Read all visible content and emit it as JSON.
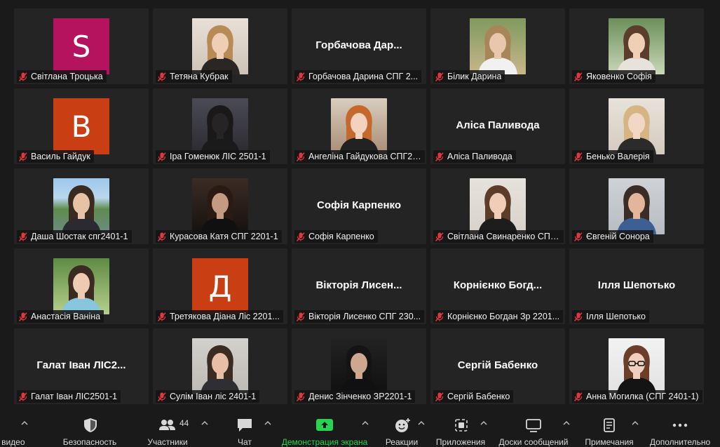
{
  "participants": [
    {
      "name": "Світлана Троцька",
      "kind": "letter",
      "letter": "S",
      "color": "#b5135d"
    },
    {
      "name": "Тетяна Кубрак",
      "kind": "photo",
      "photo": "woman-blonde"
    },
    {
      "name": "Горбачова Дарина СПГ 2...",
      "kind": "text",
      "big": "Горбачова  Дар..."
    },
    {
      "name": "Білик Дарина",
      "kind": "photo",
      "photo": "woman-outdoor"
    },
    {
      "name": "Яковенко Софія",
      "kind": "photo",
      "photo": "woman-plants"
    },
    {
      "name": "Василь Гайдук",
      "kind": "letter",
      "letter": "B",
      "color": "#c93e12"
    },
    {
      "name": "Іра Гоменюк ЛІС 2501-1",
      "kind": "photo",
      "photo": "silhouette-dusk"
    },
    {
      "name": "Ангеліна Гайдукова СПГ24...",
      "kind": "photo",
      "photo": "woman-redhair"
    },
    {
      "name": "Аліса Паливода",
      "kind": "text",
      "big": "Аліса Паливода"
    },
    {
      "name": "Бенько Валерія",
      "kind": "photo",
      "photo": "woman-light"
    },
    {
      "name": "Даша Шостак спг2401-1",
      "kind": "photo",
      "photo": "landscape-bridge"
    },
    {
      "name": "Курасова Катя СПГ 2201-1",
      "kind": "photo",
      "photo": "woman-dark"
    },
    {
      "name": "Софія Карпенко",
      "kind": "text",
      "big": "Софія Карпенко"
    },
    {
      "name": "Світлана Свинаренко СПГ ...",
      "kind": "photo",
      "photo": "woman-bun"
    },
    {
      "name": "Євгеній Сонора",
      "kind": "photo",
      "photo": "man-suit"
    },
    {
      "name": "Анастасія Ваніна",
      "kind": "photo",
      "photo": "woman-garden"
    },
    {
      "name": "Третякова Діана  Ліс 2201...",
      "kind": "letter",
      "letter": "Д",
      "color": "#c93e12"
    },
    {
      "name": "Вікторія Лисенко СПГ 230...",
      "kind": "text",
      "big": "Вікторія  Лисен..."
    },
    {
      "name": "Корнієнко Богдан Зр 2201...",
      "kind": "text",
      "big": "Корнієнко  Богд..."
    },
    {
      "name": "Ілля Шепотько",
      "kind": "text",
      "big": "Ілля Шепотько"
    },
    {
      "name": "Галат Іван ЛІС2501-1",
      "kind": "text",
      "big": "Галат Іван ЛІС2..."
    },
    {
      "name": "Сулім Іван ліс 2401-1",
      "kind": "photo",
      "photo": "man-young"
    },
    {
      "name": "Денис Зінченко ЗР2201-1",
      "kind": "photo",
      "photo": "man-hood"
    },
    {
      "name": "Сергій Бабенко",
      "kind": "text",
      "big": "Сергій Бабенко"
    },
    {
      "name": "Анна Могилка (СПГ 2401-1)",
      "kind": "photo",
      "photo": "woman-glasses"
    }
  ],
  "toolbar": {
    "video_label": "ь видео",
    "security_label": "Безопасность",
    "participants_label": "Участники",
    "participants_count": "44",
    "chat_label": "Чат",
    "share_label": "Демонстрация экрана",
    "reactions_label": "Реакции",
    "apps_label": "Приложения",
    "whiteboards_label": "Доски сообщений",
    "notes_label": "Примечания",
    "more_label": "Дополнительно"
  },
  "colors": {
    "share_green": "#26d352",
    "tile_bg": "#242424",
    "mic_red": "#e0383e"
  }
}
